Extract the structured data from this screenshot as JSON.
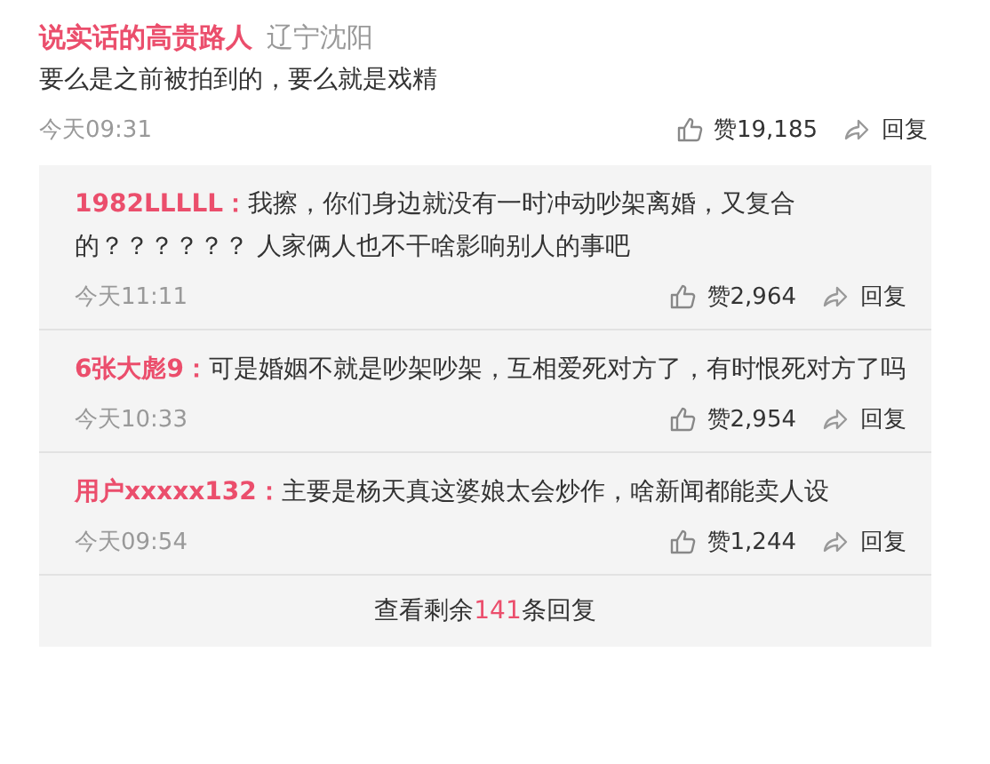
{
  "comment": {
    "author": "说实话的高贵路人",
    "location": "辽宁沈阳",
    "text": "要么是之前被拍到的，要么就是戏精",
    "time": "今天09:31",
    "likes": "赞19,185",
    "reply": "回复"
  },
  "replies": [
    {
      "author": "1982LLLLL：",
      "text": "我擦，你们身边就没有一时冲动吵架离婚，又复合的？？？？？？ 人家俩人也不干啥影响别人的事吧",
      "time": "今天11:11",
      "likes": "赞2,964",
      "reply": "回复"
    },
    {
      "author": "6张大彪9：",
      "text": "可是婚姻不就是吵架吵架，互相爱死对方了，有时恨死对方了吗",
      "time": "今天10:33",
      "likes": "赞2,954",
      "reply": "回复"
    },
    {
      "author": "用户xxxxx132：",
      "text": "主要是杨天真这婆娘太会炒作，啥新闻都能卖人设",
      "time": "今天09:54",
      "likes": "赞1,244",
      "reply": "回复"
    }
  ],
  "more": {
    "prefix": "查看剩余",
    "count": "141",
    "suffix": "条回复"
  }
}
